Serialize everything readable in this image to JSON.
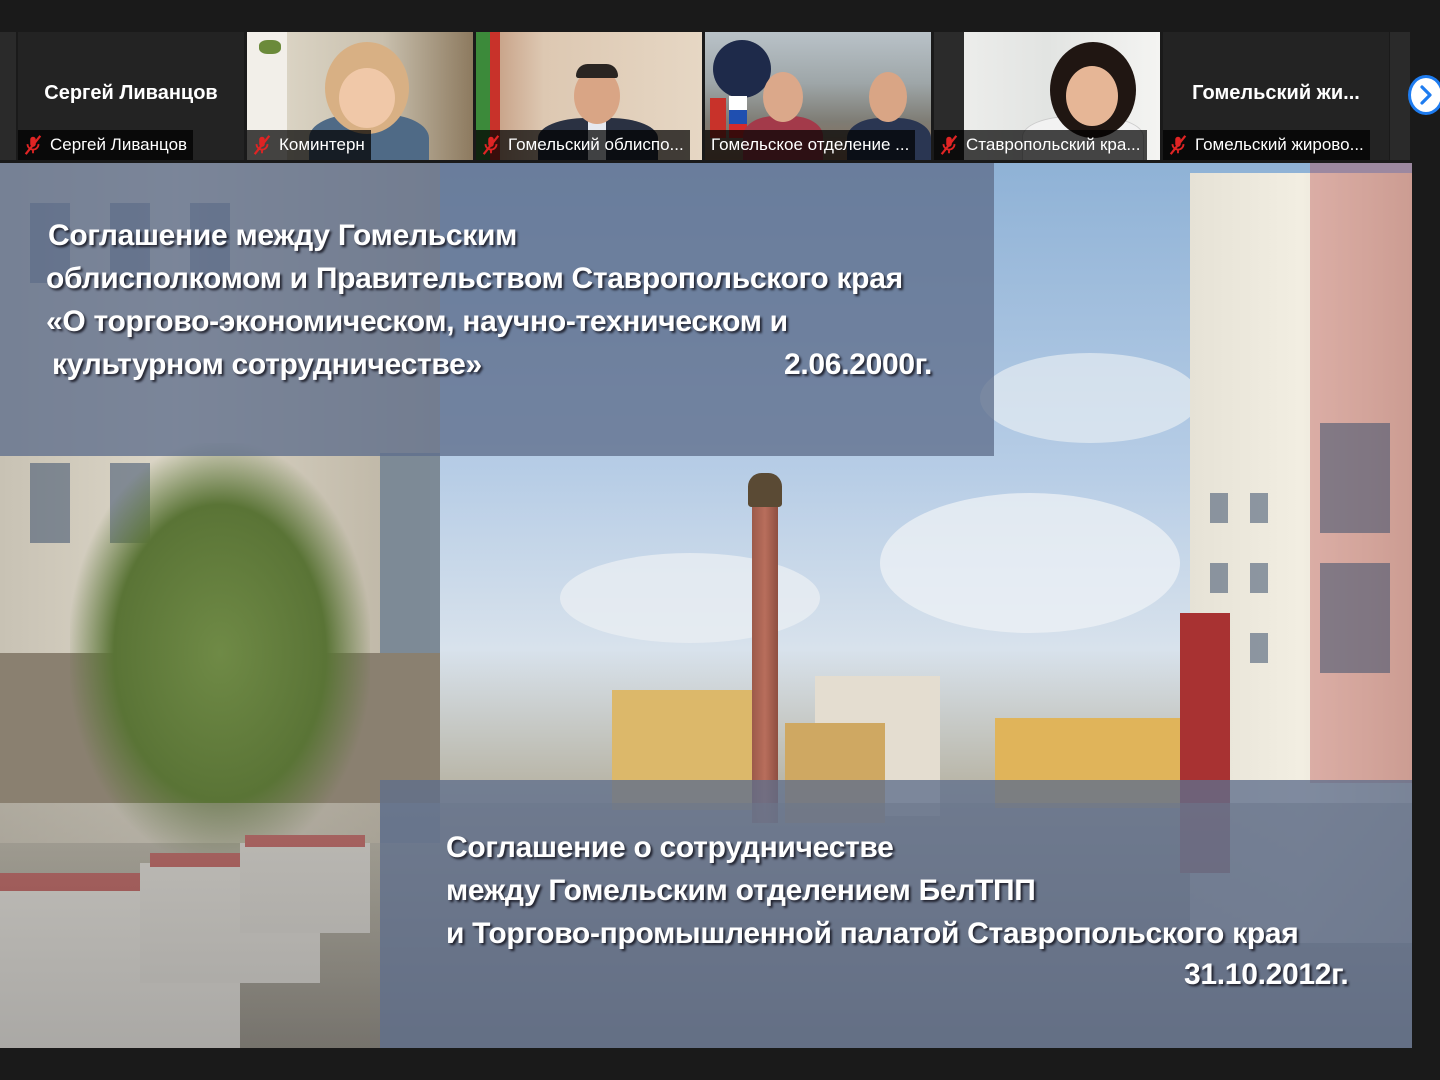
{
  "participants": [
    {
      "name_label": "Сергей Ливанцов",
      "display_name": "Сергей Ливанцов",
      "video": false,
      "muted": true
    },
    {
      "name_label": "Коминтерн",
      "video": true,
      "muted": true
    },
    {
      "name_label": "Гомельский облиспо...",
      "video": true,
      "muted": true
    },
    {
      "name_label": "Гомельское отделение ...",
      "video": true,
      "muted": false,
      "active_speaker": true
    },
    {
      "name_label": "Ставропольский кра...",
      "video": true,
      "muted": true
    },
    {
      "name_label": "Гомельский жирово...",
      "display_name": "Гомельский жи...",
      "video": false,
      "muted": true
    }
  ],
  "icons": {
    "muted": "mic-muted-icon",
    "next": "chevron-right-icon"
  },
  "colors": {
    "active_speaker_border": "#9ccc3c",
    "muted_icon": "#e02424",
    "next_button_border": "#1e7cf0"
  },
  "slide": {
    "agreement1": {
      "line1": "Соглашение между Гомельским",
      "line2": "облисполкомом и Правительством Ставропольского края",
      "line3": "«О торгово-экономическом, научно-техническом и",
      "line4": "культурном сотрудничестве»",
      "date": "2.06.2000г."
    },
    "agreement2": {
      "line1": "Соглашение о сотрудничестве",
      "line2": "между  Гомельским отделением БелТПП",
      "line3": "и  Торгово-промышленной палатой Ставропольского края",
      "date": "31.10.2012г."
    }
  }
}
